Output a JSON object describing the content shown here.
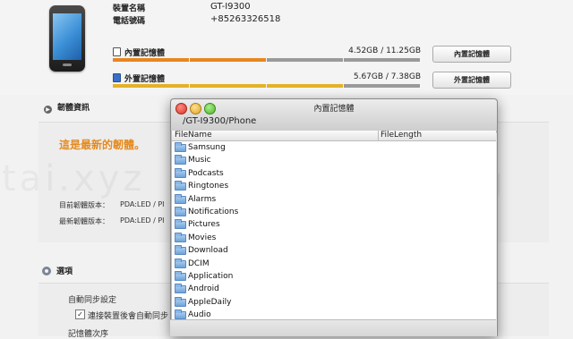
{
  "device": {
    "name_label": "裝置名稱",
    "name_value": "GT-I9300",
    "phone_label": "電話號碼",
    "phone_value": "+85263326518"
  },
  "storage": {
    "internal": {
      "label": "內置記憶體",
      "amount": "4.52GB / 11.25GB",
      "button": "內置記憶體",
      "used_fraction": 0.4
    },
    "external": {
      "label": "外置記憶體",
      "amount": "5.67GB / 7.38GB",
      "button": "外置記憶體",
      "used_fraction": 0.77
    },
    "colors": {
      "internal_used": "#e8861f",
      "external_used": "#e3b22a",
      "free": "#9a9a9a"
    }
  },
  "firmware": {
    "section_title": "韌體資訊",
    "status": "這是最新的韌體。",
    "current_label": "目前韌體版本：",
    "current_value": "PDA:LED / PI",
    "latest_label": "最新韌體版本：",
    "latest_value": "PDA:LED / PI"
  },
  "options": {
    "section_title": "選項",
    "autosync_label": "自動同步設定",
    "autosync_checkbox": "連接裝置後會自動同步",
    "memory_order_label": "記憶體次序"
  },
  "dialog": {
    "title": "內置記憶體",
    "path": "/GT-I9300/Phone",
    "columns": [
      "FileName",
      "FileLength"
    ],
    "files": [
      "Samsung",
      "Music",
      "Podcasts",
      "Ringtones",
      "Alarms",
      "Notifications",
      "Pictures",
      "Movies",
      "Download",
      "DCIM",
      "Application",
      "Android",
      "AppleDaily",
      "Audio"
    ]
  }
}
